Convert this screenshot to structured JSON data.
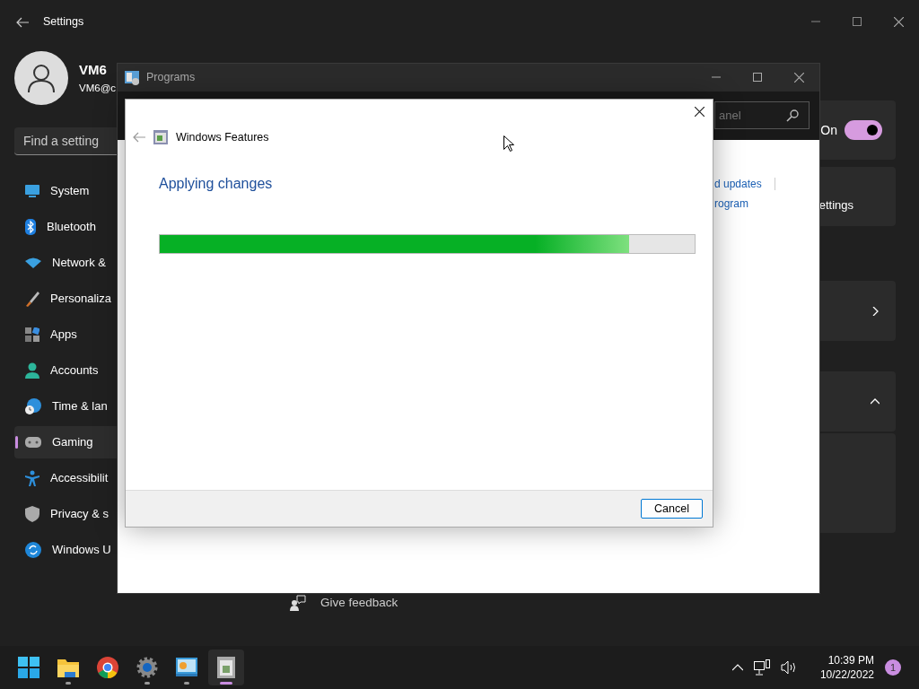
{
  "settings_window": {
    "title": "Settings",
    "user": {
      "name": "VM6",
      "email": "VM6@c"
    },
    "search": {
      "placeholder": "Find a setting"
    },
    "nav": [
      {
        "label": "System",
        "selected": false
      },
      {
        "label": "Bluetooth",
        "selected": false
      },
      {
        "label": "Network &",
        "selected": false
      },
      {
        "label": "Personaliza",
        "selected": false
      },
      {
        "label": "Apps",
        "selected": false
      },
      {
        "label": "Accounts",
        "selected": false
      },
      {
        "label": "Time & lan",
        "selected": false
      },
      {
        "label": "Gaming",
        "selected": true
      },
      {
        "label": "Accessibilit",
        "selected": false
      },
      {
        "label": "Privacy & s",
        "selected": false
      },
      {
        "label": "Windows U",
        "selected": false
      }
    ],
    "toggle": {
      "label": "On",
      "on": true
    },
    "card_text": "ettings",
    "feedback": "Give feedback"
  },
  "programs_window": {
    "title": "Programs",
    "search": {
      "placeholder": "anel"
    },
    "links": [
      "d updates",
      "rogram"
    ]
  },
  "dialog": {
    "title": "Windows Features",
    "heading": "Applying changes",
    "progress": {
      "level": 0.878
    },
    "buttons": [
      "Cancel"
    ]
  },
  "taskbar": {
    "apps": [
      {
        "kind": "start",
        "running": false,
        "active": false
      },
      {
        "kind": "explorer",
        "running": true,
        "active": false
      },
      {
        "kind": "browser",
        "running": false,
        "active": false
      },
      {
        "kind": "settings",
        "running": true,
        "active": false
      },
      {
        "kind": "control-panel",
        "running": true,
        "active": false
      },
      {
        "kind": "features",
        "running": true,
        "active": true
      }
    ],
    "time": "10:39 PM",
    "date": "10/22/2022",
    "notifications": "1"
  }
}
